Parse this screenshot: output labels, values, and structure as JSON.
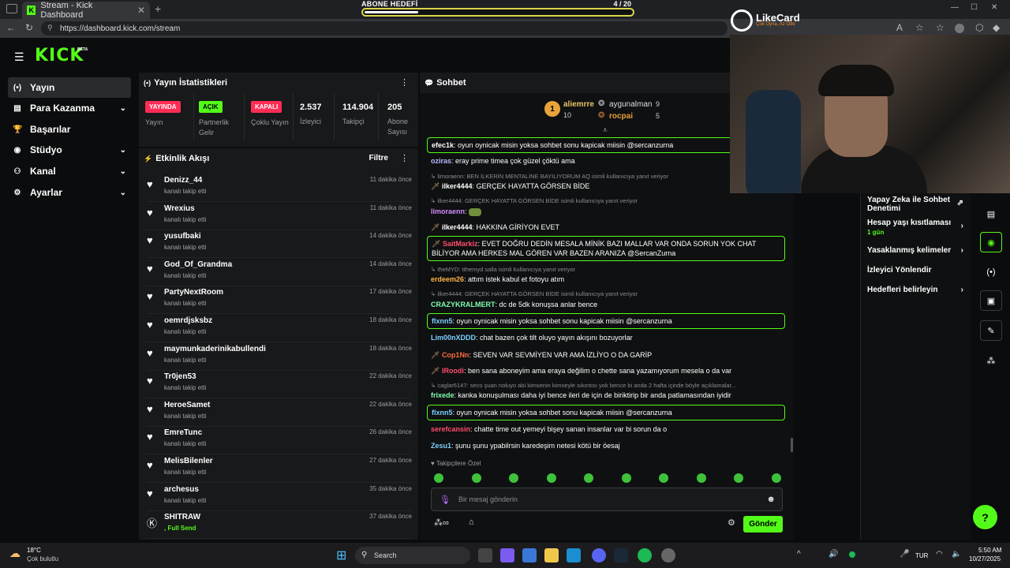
{
  "browser": {
    "tab_title": "Stream - Kick Dashboard",
    "url": "https://dashboard.kick.com/stream"
  },
  "goal": {
    "label": "ABONE HEDEFİ",
    "count": "4  / 20",
    "progress": 0.2
  },
  "likecard": {
    "name": "LikeCard",
    "tagline": "Çok Oyna, Az Öde"
  },
  "sidebar": {
    "logo": "KICK",
    "beta": "BETA",
    "items": [
      {
        "label": "Yayın",
        "icon": "(•)"
      },
      {
        "label": "Para Kazanma",
        "icon": "▤"
      },
      {
        "label": "Başarılar",
        "icon": "🏆"
      },
      {
        "label": "Stüdyo",
        "icon": "◉"
      },
      {
        "label": "Kanal",
        "icon": "⚇"
      },
      {
        "label": "Ayarlar",
        "icon": "⚙"
      }
    ]
  },
  "stats": {
    "title": "Yayın İstatistikleri",
    "cols": [
      {
        "badge": "YAYINDA",
        "label": "Yayın"
      },
      {
        "badge": "AÇIK",
        "label": "Partnerlik Gelir"
      },
      {
        "badge": "KAPALI",
        "label": "Çoklu Yayın"
      },
      {
        "value": "2.537",
        "label": "İzleyici"
      },
      {
        "value": "114.904",
        "label": "Takipçi"
      },
      {
        "value": "205",
        "label": "Abone Sayısı"
      }
    ]
  },
  "activity": {
    "title": "Etkinlik Akışı",
    "filter": "Filtre",
    "items": [
      {
        "name": "Denizz_44",
        "sub": "kanalı takip etti",
        "time": "11 dakika önce"
      },
      {
        "name": "Wrexius",
        "sub": "kanalı takip etti",
        "time": "11 dakika önce"
      },
      {
        "name": "yusufbaki",
        "sub": "kanalı takip etti",
        "time": "14 dakika önce"
      },
      {
        "name": "God_Of_Grandma",
        "sub": "kanalı takip etti",
        "time": "14 dakika önce"
      },
      {
        "name": "PartyNextRoom",
        "sub": "kanalı takip etti",
        "time": "17 dakika önce"
      },
      {
        "name": "oemrdjsksbz",
        "sub": "kanalı takip etti",
        "time": "18 dakika önce"
      },
      {
        "name": "maymunkaderinikabullendi",
        "sub": "kanalı takip etti",
        "time": "18 dakika önce"
      },
      {
        "name": "Tr0jen53",
        "sub": "kanalı takip etti",
        "time": "22 dakika önce"
      },
      {
        "name": "HeroeSamet",
        "sub": "kanalı takip etti",
        "time": "22 dakika önce"
      },
      {
        "name": "EmreTunc",
        "sub": "kanalı takip etti",
        "time": "26 dakika önce"
      },
      {
        "name": "MelisBilenler",
        "sub": "kanalı takip etti",
        "time": "27 dakika önce"
      },
      {
        "name": "archesus",
        "sub": "kanalı takip etti",
        "time": "35 dakika önce"
      },
      {
        "name": "SHITRAW",
        "sub": ", Full Send",
        "time": "37 dakika önce"
      }
    ]
  },
  "chat": {
    "title": "Sohbet",
    "leaders": [
      {
        "name": "aliemrre",
        "count": "10"
      },
      {
        "name": "aygunalman",
        "count": "9"
      },
      {
        "name": "rocpai",
        "count": "5"
      }
    ],
    "pinned_text": "oyun oynicak misin yoksa sohbet sonu kapicak miisin @sercanzurna",
    "messages": [
      {
        "kind": "pin",
        "user": "efec1k",
        "color": "#ffffff",
        "text": "oyun oynicak misin yoksa sohbet sonu kapicak miisin @sercanzurna"
      },
      {
        "kind": "msg",
        "user": "oziras",
        "color": "#b9b9ff",
        "text": "eray prime timea çok güzel çöktü ama"
      },
      {
        "kind": "reply",
        "text": "limoraenn: BEN İLKERİN MENTALİNE BAYILIYORUM AQ isimli kullanıcıya yanıt veriyor"
      },
      {
        "kind": "msg",
        "user": "ilker4444",
        "color": "#ffffff",
        "text": "GERÇEK HAYATTA GÖRSEN BİDE"
      },
      {
        "kind": "reply",
        "text": "ilker4444: GERÇEK HAYATTA GÖRSEN BİDE isimli kullanıcıya yanıt veriyor"
      },
      {
        "kind": "msg",
        "user": "limoraenn",
        "color": "#d38cff",
        "text": ""
      },
      {
        "kind": "msg",
        "user": "ilker4444",
        "color": "#ffffff",
        "text": "HAKKINA GİRİYON EVET"
      },
      {
        "kind": "pin2",
        "user": "SaitMarkiz",
        "color": "#ff4d6d",
        "text": "EVET DOĞRU DEDİN MESALA MİNİK BAZI MALLAR VAR ONDA SORUN YOK CHAT BİLİYOR AMA HERKES MAL GÖREN VAR BAZEN ARANIZA @SercanZurna"
      },
      {
        "kind": "reply",
        "text": "theMYD: tthemyd salla isimli kullanıcıya yanıt veriyor"
      },
      {
        "kind": "msg",
        "user": "erdeem26",
        "color": "#ffb347",
        "text": "attım istek kabul et fotoyu atım"
      },
      {
        "kind": "reply",
        "text": "ilker4444: GERÇEK HAYATTA GÖRSEN BİDE isimli kullanıcıya yanıt veriyor"
      },
      {
        "kind": "msg",
        "user": "CRAZYKRALMERT",
        "color": "#7dffb0",
        "text": "dc de 5dk konuşsa anlar bence"
      },
      {
        "kind": "pin",
        "user": "flxnn5",
        "color": "#7ad0ff",
        "text": "oyun oynicak misin yoksa sohbet sonu kapicak miisin @sercanzurna"
      },
      {
        "kind": "msg",
        "user": "Lim00nXDDD",
        "color": "#7ad0ff",
        "text": "chat bazen çok tilt oluyo yayın akışını bozuyorlar"
      },
      {
        "kind": "msg",
        "user": "Cop1Nn",
        "color": "#ff6b3d",
        "text": "SEVEN VAR SEVMİYEN VAR AMA İZLİYO O DA GARİP"
      },
      {
        "kind": "msg",
        "user": "IRoodi",
        "color": "#ff4d6d",
        "text": "ben sana aboneyim ama eraya değilim o chette sana yazamıyorum mesela o da var"
      },
      {
        "kind": "reply",
        "text": "caglar6147: seco şuan noluyo abi kimsenin kimseyle sıkıntısı yok bence bi anda 2 hafta içinde böyle açıklamalar..."
      },
      {
        "kind": "msg",
        "user": "frixede",
        "color": "#7dffb0",
        "text": "kanka konuşulması daha iyi bence ileri de için de biriktirip bir anda patlamasından iyidir"
      },
      {
        "kind": "pin",
        "user": "flxnn5",
        "color": "#7ad0ff",
        "text": "oyun oynicak misin yoksa sohbet sonu kapicak miisin @sercanzurna"
      },
      {
        "kind": "msg",
        "user": "serefcansin",
        "color": "#ff4d6d",
        "text": "chatte time out yemeyi bişey sanan insanlar var bi sorun da o"
      },
      {
        "kind": "msg",
        "user": "Zesu1",
        "color": "#7ad0ff",
        "text": "şunu şunu ypabilrsin karedeşim netesi kötü bir öesaj"
      }
    ],
    "followers_only": "Takipçilere Özel",
    "placeholder": "Bir mesaj gönderin",
    "send": "Gönder"
  },
  "rightpanel": {
    "items": [
      {
        "label": "Yapay Zeka ile Sohbet Denetimi",
        "sub": ""
      },
      {
        "label": "Hesap yaşı kısıtlaması",
        "sub": "1 gün"
      },
      {
        "label": "Yasaklanmış kelimeler",
        "sub": ""
      },
      {
        "label": "İzleyici Yönlendir",
        "sub": ""
      },
      {
        "label": "Hedefleri belirleyin",
        "sub": ""
      }
    ]
  },
  "taskbar": {
    "temp": "18°C",
    "weather": "Çok bulutlu",
    "search": "Search",
    "lang": "TUR",
    "time": "5:50 AM",
    "date": "10/27/2025"
  },
  "colors": {
    "accent": "#53fc18",
    "live": "#ff2d55",
    "on": "#53fc18",
    "off": "#ff2d55"
  }
}
